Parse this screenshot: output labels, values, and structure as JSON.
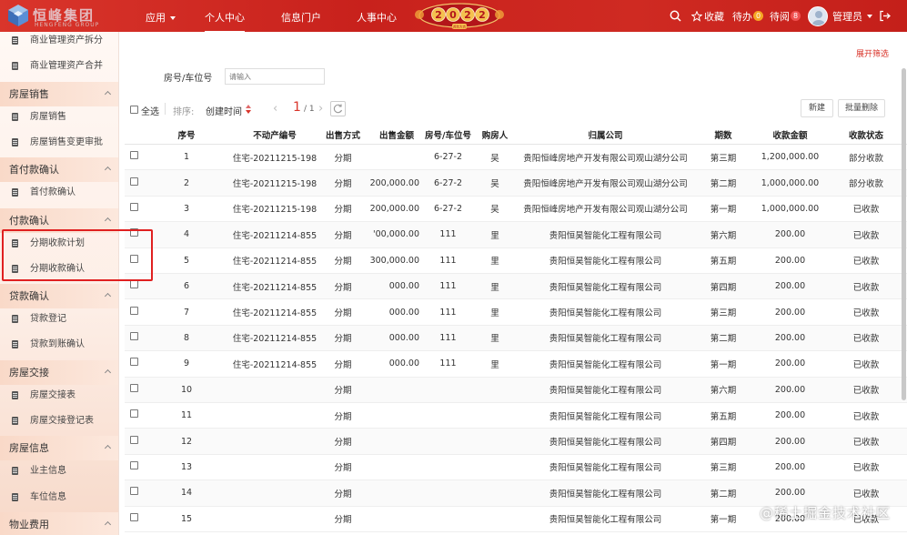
{
  "header": {
    "logo_text": "恒峰集团",
    "logo_sub": "HENGFENG GROUP",
    "nav": [
      {
        "label": "应用",
        "has_caret": true
      },
      {
        "label": "个人中心",
        "active": true
      },
      {
        "label": "信息门户"
      },
      {
        "label": "人事中心"
      }
    ],
    "banner_year": "2022",
    "banner_sub": "虎年大吉",
    "favorites": "收藏",
    "todo_label": "待办",
    "todo_count": "0",
    "toread_label": "待阅",
    "toread_count": "8",
    "user_name": "管理员",
    "accent_color": "#c8211c"
  },
  "sidebar": {
    "items": [
      {
        "type": "item",
        "label": "商业管理资产拆分"
      },
      {
        "type": "item",
        "label": "商业管理资产合并"
      },
      {
        "type": "group",
        "label": "房屋销售"
      },
      {
        "type": "item",
        "label": "房屋销售"
      },
      {
        "type": "item",
        "label": "房屋销售变更审批"
      },
      {
        "type": "group",
        "label": "首付款确认"
      },
      {
        "type": "item",
        "label": "首付款确认"
      },
      {
        "type": "group",
        "label": "付款确认"
      },
      {
        "type": "item",
        "label": "分期收款计划"
      },
      {
        "type": "item",
        "label": "分期收款确认"
      },
      {
        "type": "group",
        "label": "贷款确认"
      },
      {
        "type": "item",
        "label": "贷款登记"
      },
      {
        "type": "item",
        "label": "贷款到账确认"
      },
      {
        "type": "group",
        "label": "房屋交接"
      },
      {
        "type": "item",
        "label": "房屋交接表"
      },
      {
        "type": "item",
        "label": "房屋交接登记表"
      },
      {
        "type": "group",
        "label": "房屋信息"
      },
      {
        "type": "item",
        "label": "业主信息"
      },
      {
        "type": "item",
        "label": "车位信息"
      },
      {
        "type": "group",
        "label": "物业费用"
      }
    ]
  },
  "main": {
    "filter_toggle": "展开筛选",
    "filter_label": "房号/车位号",
    "filter_placeholder": "请输入",
    "select_all": "全选",
    "sort_label": "排序:",
    "sort_field": "创建时间",
    "page_current": "1",
    "page_total": "/ 1",
    "btn_new": "新建",
    "btn_batch_delete": "批量删除"
  },
  "table": {
    "columns": [
      "序号",
      "不动产编号",
      "出售方式",
      "出售金额",
      "房号/车位号",
      "购房人",
      "归属公司",
      "期数",
      "收款金额",
      "收款状态"
    ],
    "rows": [
      [
        "1",
        "住宅-20211215-198",
        "分期",
        "",
        "6-27-2",
        "吴",
        "贵阳恒峰房地产开发有限公司观山湖分公司",
        "第三期",
        "1,200,000.00",
        "部分收款"
      ],
      [
        "2",
        "住宅-20211215-198",
        "分期",
        ",200,000.00",
        "6-27-2",
        "吴",
        "贵阳恒峰房地产开发有限公司观山湖分公司",
        "第二期",
        "1,000,000.00",
        "部分收款"
      ],
      [
        "3",
        "住宅-20211215-198",
        "分期",
        "200,000.00",
        "6-27-2",
        "吴",
        "贵阳恒峰房地产开发有限公司观山湖分公司",
        "第一期",
        "1,000,000.00",
        "已收款"
      ],
      [
        "4",
        "住宅-20211214-855",
        "分期",
        "'00,000.00",
        "111",
        "里",
        "贵阳恒昊智能化工程有限公司",
        "第六期",
        "200.00",
        "已收款"
      ],
      [
        "5",
        "住宅-20211214-855",
        "分期",
        "300,000.00",
        "111",
        "里",
        "贵阳恒昊智能化工程有限公司",
        "第五期",
        "200.00",
        "已收款"
      ],
      [
        "6",
        "住宅-20211214-855",
        "分期",
        "000.00",
        "111",
        "里",
        "贵阳恒昊智能化工程有限公司",
        "第四期",
        "200.00",
        "已收款"
      ],
      [
        "7",
        "住宅-20211214-855",
        "分期",
        "000.00",
        "111",
        "里",
        "贵阳恒昊智能化工程有限公司",
        "第三期",
        "200.00",
        "已收款"
      ],
      [
        "8",
        "住宅-20211214-855",
        "分期",
        "000.00",
        "111",
        "里",
        "贵阳恒昊智能化工程有限公司",
        "第二期",
        "200.00",
        "已收款"
      ],
      [
        "9",
        "住宅-20211214-855",
        "分期",
        "000.00",
        "111",
        "里",
        "贵阳恒昊智能化工程有限公司",
        "第一期",
        "200.00",
        "已收款"
      ],
      [
        "10",
        "",
        "分期",
        "",
        "",
        "",
        "贵阳恒昊智能化工程有限公司",
        "第六期",
        "200.00",
        "已收款"
      ],
      [
        "11",
        "",
        "分期",
        "",
        "",
        "",
        "贵阳恒昊智能化工程有限公司",
        "第五期",
        "200.00",
        "已收款"
      ],
      [
        "12",
        "",
        "分期",
        "",
        "",
        "",
        "贵阳恒昊智能化工程有限公司",
        "第四期",
        "200.00",
        "已收款"
      ],
      [
        "13",
        "",
        "分期",
        "",
        "",
        "",
        "贵阳恒昊智能化工程有限公司",
        "第三期",
        "200.00",
        "已收款"
      ],
      [
        "14",
        "",
        "分期",
        "",
        "",
        "",
        "贵阳恒昊智能化工程有限公司",
        "第二期",
        "200.00",
        "已收款"
      ],
      [
        "15",
        "",
        "分期",
        "",
        "",
        "",
        "贵阳恒昊智能化工程有限公司",
        "第一期",
        "200.00",
        "已收款"
      ]
    ]
  },
  "watermark": "@稀土掘金技术社区"
}
